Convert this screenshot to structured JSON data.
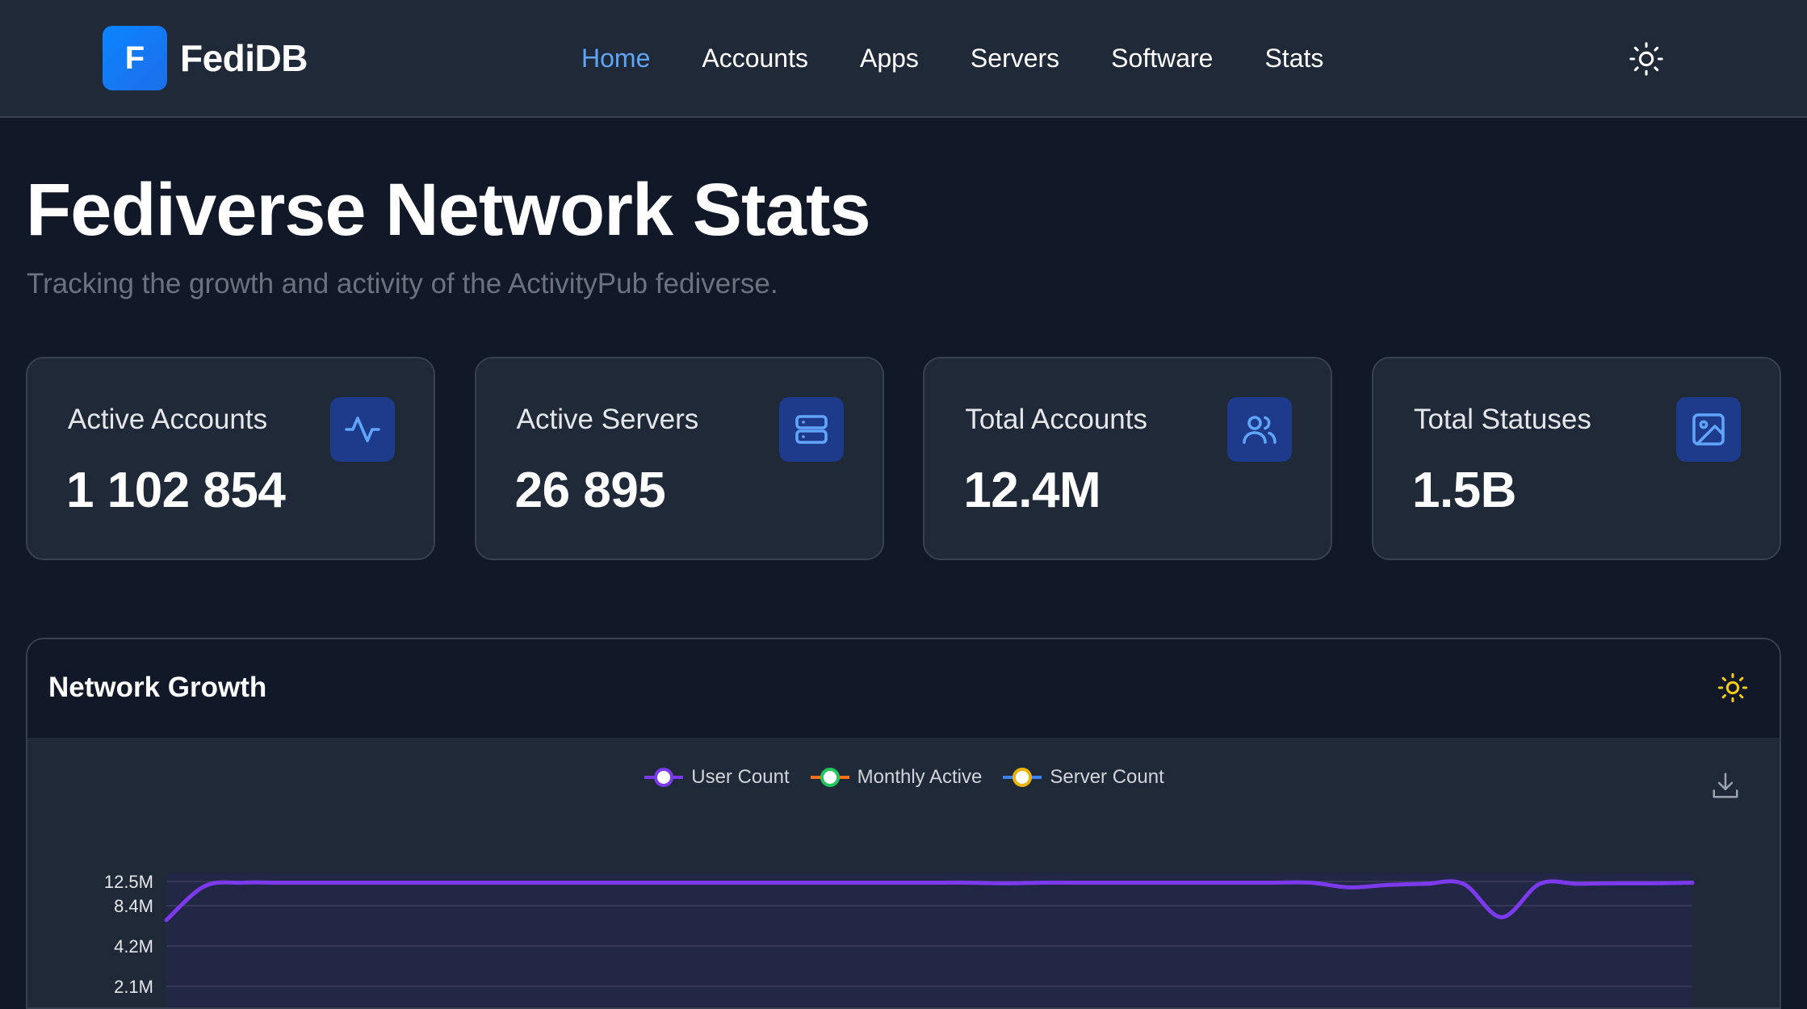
{
  "brand": {
    "mark": "F",
    "name": "FediDB"
  },
  "nav": {
    "items": [
      {
        "label": "Home",
        "active": true
      },
      {
        "label": "Accounts",
        "active": false
      },
      {
        "label": "Apps",
        "active": false
      },
      {
        "label": "Servers",
        "active": false
      },
      {
        "label": "Software",
        "active": false
      },
      {
        "label": "Stats",
        "active": false
      }
    ]
  },
  "theme_toggle": {
    "icon": "sun-icon"
  },
  "hero": {
    "title": "Fediverse Network Stats",
    "subtitle": "Tracking the growth and activity of the ActivityPub fediverse."
  },
  "stats": [
    {
      "label": "Active Accounts",
      "value": "1 102 854",
      "icon": "activity-icon"
    },
    {
      "label": "Active Servers",
      "value": "26 895",
      "icon": "server-icon"
    },
    {
      "label": "Total Accounts",
      "value": "12.4M",
      "icon": "users-icon"
    },
    {
      "label": "Total Statuses",
      "value": "1.5B",
      "icon": "image-icon"
    }
  ],
  "panel": {
    "title": "Network Growth",
    "theme_icon": "sun-icon",
    "download_icon": "download-icon"
  },
  "colors": {
    "accent": "#60a5fa",
    "user_count": "#7c3aed",
    "monthly_active": "#22c55e",
    "server_count": "#eab308"
  },
  "chart_data": {
    "type": "line",
    "ylabel": "",
    "xlabel": "",
    "y_ticks": [
      "12.5M",
      "8.4M",
      "4.2M",
      "2.1M"
    ],
    "y_tick_values": [
      12500000,
      8400000,
      4200000,
      2100000
    ],
    "legend": [
      {
        "name": "User Count",
        "color": "#7c3aed"
      },
      {
        "name": "Monthly Active",
        "color": "#22c55e"
      },
      {
        "name": "Server Count",
        "color": "#eab308"
      }
    ],
    "series": [
      {
        "name": "User Count",
        "values": [
          6900000,
          11700000,
          12300000,
          12300000,
          12300000,
          12300000,
          12300000,
          12300000,
          12300000,
          12300000,
          12300000,
          12300000,
          12300000,
          12300000,
          12300000,
          12300000,
          12300000,
          12300000,
          12300000,
          12300000,
          12300000,
          12300000,
          12200000,
          12300000,
          12300000,
          12300000,
          12300000,
          12300000,
          12300000,
          12300000,
          12300000,
          11500000,
          11900000,
          12100000,
          12100000,
          7200000,
          12100000,
          12100000,
          12200000,
          12200000,
          12300000
        ]
      }
    ]
  }
}
